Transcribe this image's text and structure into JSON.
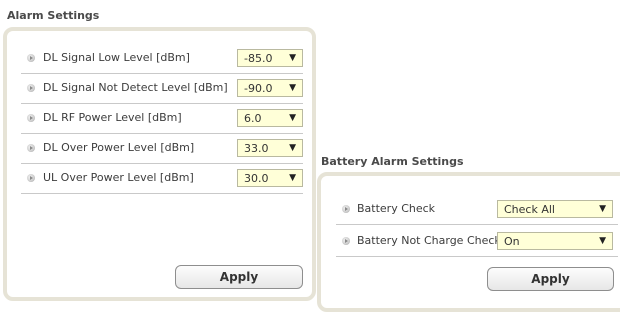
{
  "alarm": {
    "title": "Alarm Settings",
    "rows": [
      {
        "label": "DL Signal Low Level [dBm]",
        "value": "-85.0"
      },
      {
        "label": "DL Signal Not Detect Level [dBm]",
        "value": "-90.0"
      },
      {
        "label": "DL RF Power Level [dBm]",
        "value": "6.0"
      },
      {
        "label": "DL Over Power Level [dBm]",
        "value": "33.0"
      },
      {
        "label": "UL Over Power Level [dBm]",
        "value": "30.0"
      }
    ],
    "apply_label": "Apply"
  },
  "battery": {
    "title": "Battery Alarm Settings",
    "rows": [
      {
        "label": "Battery Check",
        "value": "Check All"
      },
      {
        "label": "Battery Not Charge Check",
        "value": "On"
      }
    ],
    "apply_label": "Apply"
  },
  "colors": {
    "panel_border": "#e6e3d6",
    "dropdown_bg": "#ffffd8",
    "divider": "#c9c9c9"
  }
}
